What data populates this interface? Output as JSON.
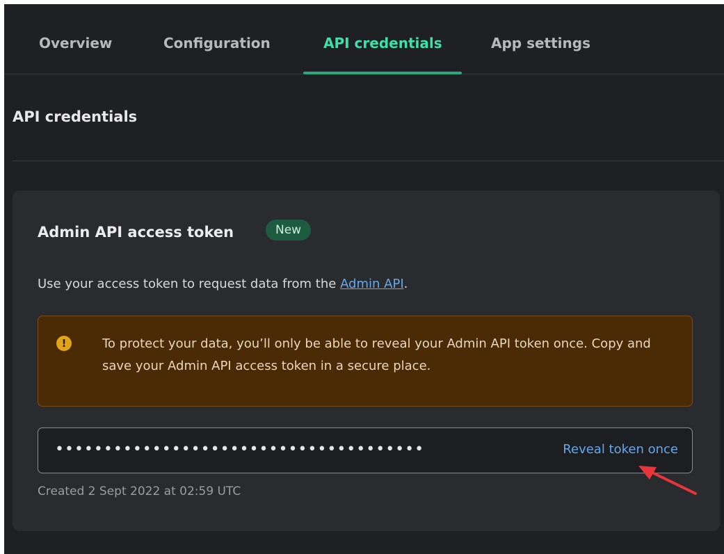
{
  "tabs": [
    {
      "label": "Overview",
      "active": false
    },
    {
      "label": "Configuration",
      "active": false
    },
    {
      "label": "API credentials",
      "active": true
    },
    {
      "label": "App settings",
      "active": false
    }
  ],
  "section": {
    "title": "API credentials"
  },
  "card": {
    "title": "Admin API access token",
    "badge": "New",
    "description_prefix": "Use your access token to request data from the ",
    "description_link": "Admin API",
    "description_suffix": ".",
    "warning": {
      "icon": "exclamation-icon",
      "text": "To protect your data, you’ll only be able to reveal your Admin API token once. Copy and save your Admin API access token in a secure place."
    },
    "token": {
      "masked_value": "••••••••••••••••••••••••••••••••••••••",
      "reveal_label": "Reveal token once"
    },
    "created": "Created 2 Sept 2022 at 02:59 UTC"
  },
  "colors": {
    "background": "#1f2023",
    "card": "#2a2b2e",
    "accent_green": "#3ee0a8",
    "link_blue": "#63a9ee",
    "warning_bg": "#4b2a06",
    "annotation_red": "#e8353a"
  }
}
